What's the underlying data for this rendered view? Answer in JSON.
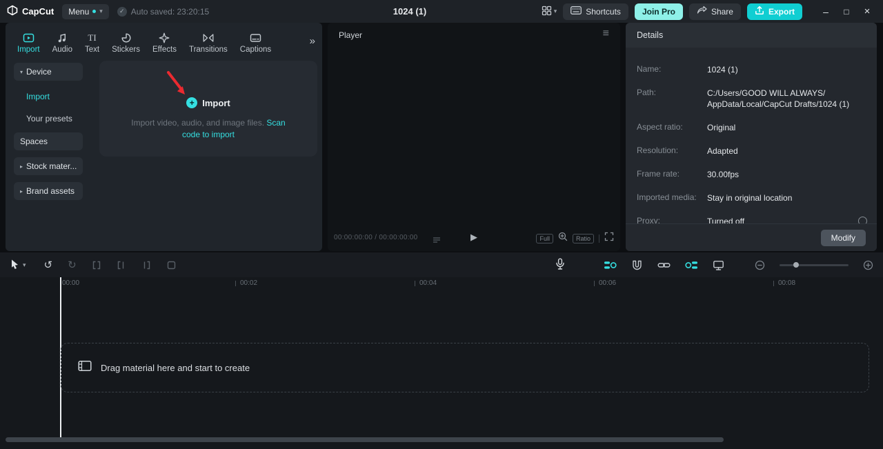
{
  "titlebar": {
    "logo_text": "CapCut",
    "menu_label": "Menu",
    "autosave": "Auto saved: 23:20:15",
    "doc_title": "1024 (1)",
    "shortcuts_label": "Shortcuts",
    "join_pro_label": "Join Pro",
    "share_label": "Share",
    "export_label": "Export"
  },
  "media_panel": {
    "tabs": [
      {
        "label": "Import"
      },
      {
        "label": "Audio"
      },
      {
        "label": "Text"
      },
      {
        "label": "Stickers"
      },
      {
        "label": "Effects"
      },
      {
        "label": "Transitions"
      },
      {
        "label": "Captions"
      }
    ],
    "sidebar": {
      "device": "Device",
      "import": "Import",
      "your_presets": "Your presets",
      "spaces": "Spaces",
      "stock": "Stock mater...",
      "brand": "Brand assets"
    },
    "import_card": {
      "title": "Import",
      "description": "Import video, audio, and image files. ",
      "link": "Scan code to import"
    }
  },
  "player": {
    "title": "Player",
    "timecode": "00:00:00:00 / 00:00:00:00",
    "full_label": "Full",
    "ratio_label": "Ratio"
  },
  "details": {
    "title": "Details",
    "rows": [
      {
        "label": "Name:",
        "value": "1024 (1)"
      },
      {
        "label": "Path:",
        "value_lines": [
          "C:/Users/GOOD WILL ALWAYS/",
          "AppData/Local/CapCut Drafts/1024 (1)"
        ]
      },
      {
        "label": "Aspect ratio:",
        "value": "Original"
      },
      {
        "label": "Resolution:",
        "value": "Adapted"
      },
      {
        "label": "Frame rate:",
        "value": "30.00fps"
      },
      {
        "label": "Imported media:",
        "value": "Stay in original location"
      },
      {
        "label": "Proxy:",
        "value": "Turned off"
      }
    ],
    "modify_label": "Modify"
  },
  "timeline": {
    "ruler": [
      "00:00",
      "00:02",
      "00:04",
      "00:06",
      "00:08"
    ],
    "dropzone_text": "Drag material here and start to create"
  },
  "icons": {
    "caret_down": "▾",
    "caret_right": "▸",
    "double_chevron": "»",
    "check": "✓",
    "hamburger": "≡",
    "play": "▶",
    "undo": "↺",
    "redo": "↻",
    "minimize": "–",
    "maximize": "□",
    "close": "×",
    "plus": "+",
    "text_tab": "TI"
  },
  "colors": {
    "accent": "#35dfe1",
    "export_button": "#10ced2",
    "join_pro_button": "#8ef0e8",
    "arrow_red": "#ea2a30"
  }
}
